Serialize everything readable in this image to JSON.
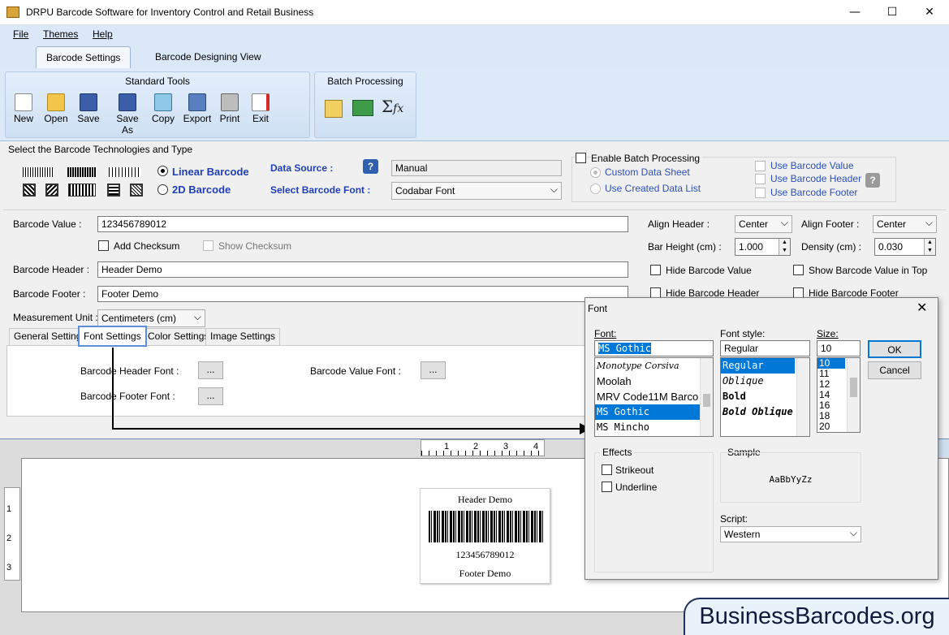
{
  "window": {
    "title": "DRPU Barcode Software for Inventory Control and Retail Business",
    "minimize": "—",
    "maximize": "☐",
    "close": "✕"
  },
  "menu": {
    "file": "File",
    "themes": "Themes",
    "help": "Help"
  },
  "tabs": {
    "settings": "Barcode Settings",
    "designing": "Barcode Designing View"
  },
  "ribbon": {
    "standard_title": "Standard Tools",
    "batch_title": "Batch Processing",
    "tools": [
      "New",
      "Open",
      "Save",
      "Save As",
      "Copy",
      "Export",
      "Print",
      "Exit"
    ]
  },
  "tech": {
    "section_label": "Select the Barcode Technologies and Type",
    "linear": "Linear Barcode",
    "two_d": "2D Barcode",
    "data_source_label": "Data Source :",
    "data_source_value": "Manual",
    "font_label": "Select Barcode Font :",
    "font_value": "Codabar Font"
  },
  "batch": {
    "enable": "Enable Batch Processing",
    "custom_sheet": "Custom Data Sheet",
    "created_list": "Use Created Data List",
    "use_value": "Use Barcode Value",
    "use_header": "Use Barcode Header",
    "use_footer": "Use Barcode Footer"
  },
  "form": {
    "value_label": "Barcode Value :",
    "value": "123456789012",
    "add_checksum": "Add Checksum",
    "show_checksum": "Show Checksum",
    "header_label": "Barcode Header :",
    "header": "Header Demo",
    "footer_label": "Barcode Footer :",
    "footer": "Footer Demo",
    "unit_label": "Measurement Unit :",
    "unit": "Centimeters (cm)"
  },
  "right": {
    "align_header_label": "Align Header :",
    "align_header": "Center",
    "align_footer_label": "Align Footer :",
    "align_footer": "Center",
    "bar_height_label": "Bar Height (cm) :",
    "bar_height": "1.000",
    "density_label": "Density (cm) :",
    "density": "0.030",
    "hide_value": "Hide Barcode Value",
    "show_value_top": "Show Barcode Value in Top",
    "hide_header": "Hide Barcode Header",
    "hide_footer": "Hide Barcode Footer"
  },
  "subtabs": [
    "General Settings",
    "Font Settings",
    "Color Settings",
    "Image Settings"
  ],
  "font_settings": {
    "header_font": "Barcode Header Font :",
    "value_font": "Barcode Value Font :",
    "footer_font": "Barcode Footer Font :",
    "browse": "..."
  },
  "ruler": {
    "h": [
      "1",
      "2",
      "3",
      "4"
    ],
    "v": [
      "1",
      "2",
      "3"
    ]
  },
  "preview": {
    "header": "Header Demo",
    "value": "123456789012",
    "footer": "Footer Demo"
  },
  "font_dialog": {
    "title": "Font",
    "font_label": "Font:",
    "font_value": "MS Gothic",
    "fonts": [
      "Monotype Corsiva",
      "Moolah",
      "MRV Code11M Barco",
      "MS Gothic",
      "MS Mincho"
    ],
    "style_label": "Font style:",
    "style_value": "Regular",
    "styles": [
      "Regular",
      "Oblique",
      "Bold",
      "Bold Oblique"
    ],
    "size_label": "Size:",
    "size_value": "10",
    "sizes": [
      "10",
      "11",
      "12",
      "14",
      "16",
      "18",
      "20"
    ],
    "ok": "OK",
    "cancel": "Cancel",
    "effects_label": "Effects",
    "strikeout": "Strikeout",
    "underline": "Underline",
    "sample_label": "Sample",
    "sample_text": "AaBbYyZz",
    "script_label": "Script:",
    "script_value": "Western"
  },
  "watermark": "BusinessBarcodes.org"
}
